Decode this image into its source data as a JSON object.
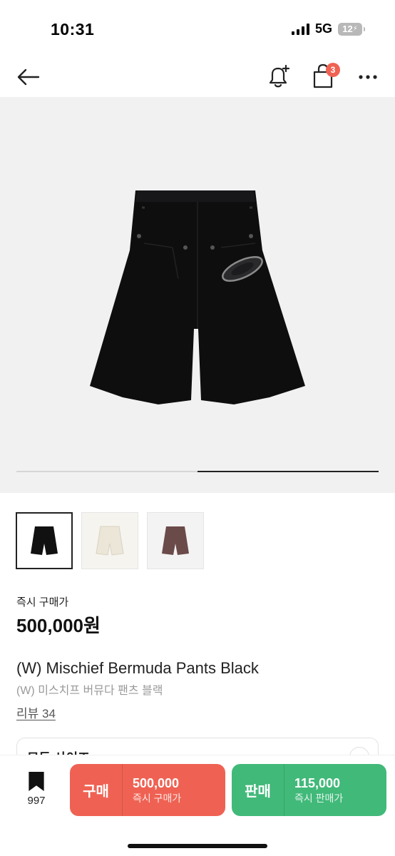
{
  "status_bar": {
    "time": "10:31",
    "network": "5G",
    "battery": "12"
  },
  "nav": {
    "back_icon": "arrow-left-icon",
    "bell_icon": "bell-plus-icon",
    "cart_icon": "shopping-bag-icon",
    "cart_badge": "3",
    "more_icon": "more-horizontal-icon"
  },
  "gallery": {
    "progress": 0.5,
    "thumbnails": [
      {
        "name": "black",
        "color": "#111111",
        "active": true
      },
      {
        "name": "ivory",
        "color": "#ece6d8",
        "active": false
      },
      {
        "name": "brown",
        "color": "#6b4a4a",
        "active": false
      }
    ]
  },
  "product": {
    "price_label": "즉시 구매가",
    "price": "500,000원",
    "title": "(W) Mischief Bermuda Pants Black",
    "subtitle": "(W) 미스치프 버뮤다 팬츠 블랙",
    "reviews": "리뷰 34",
    "size_label": "모든 사이즈"
  },
  "bottom_bar": {
    "wish_icon": "bookmark-icon",
    "wish_count": "997",
    "buy": {
      "label": "구매",
      "price": "500,000",
      "sub": "즉시 구매가",
      "color": "#ef6253"
    },
    "sell": {
      "label": "판매",
      "price": "115,000",
      "sub": "즉시 판매가",
      "color": "#41b979"
    }
  }
}
